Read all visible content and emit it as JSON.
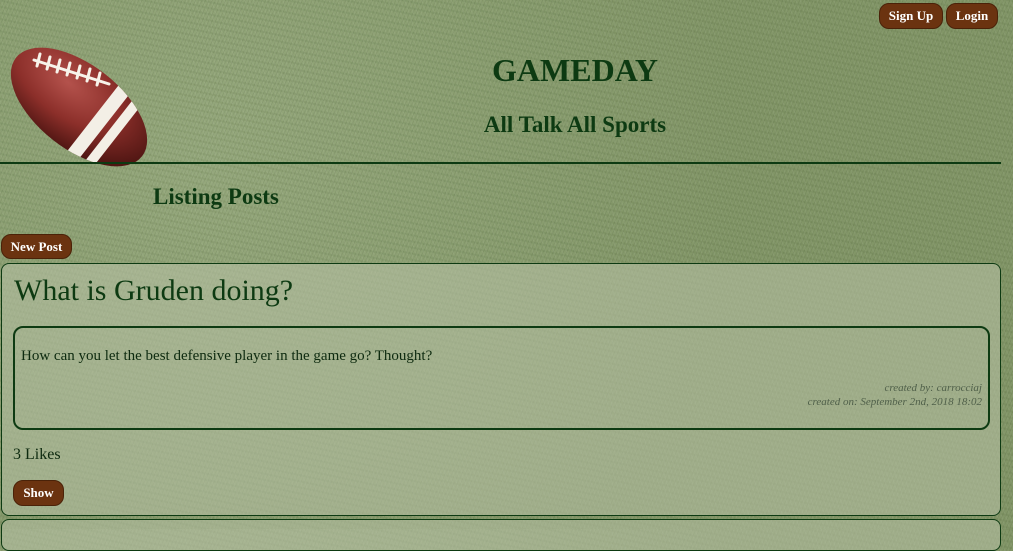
{
  "header": {
    "signup_label": "Sign Up",
    "login_label": "Login",
    "site_title": "GAMEDAY",
    "tagline": "All Talk All Sports"
  },
  "main": {
    "heading": "Listing Posts",
    "new_post_label": "New Post",
    "posts": [
      {
        "title": "What is Gruden doing?",
        "body": "How can you let the best defensive player in the game go? Thought?",
        "created_by": "created by: carrocciaj",
        "created_on": "created on: September 2nd, 2018 18:02",
        "likes": "3 Likes",
        "show_label": "Show"
      }
    ]
  },
  "colors": {
    "text": "#0d3a12",
    "button": "#6b3310",
    "button_text": "#ffffff",
    "background": "#8a9d72"
  },
  "icons": {
    "logo": "football-logo-icon"
  }
}
